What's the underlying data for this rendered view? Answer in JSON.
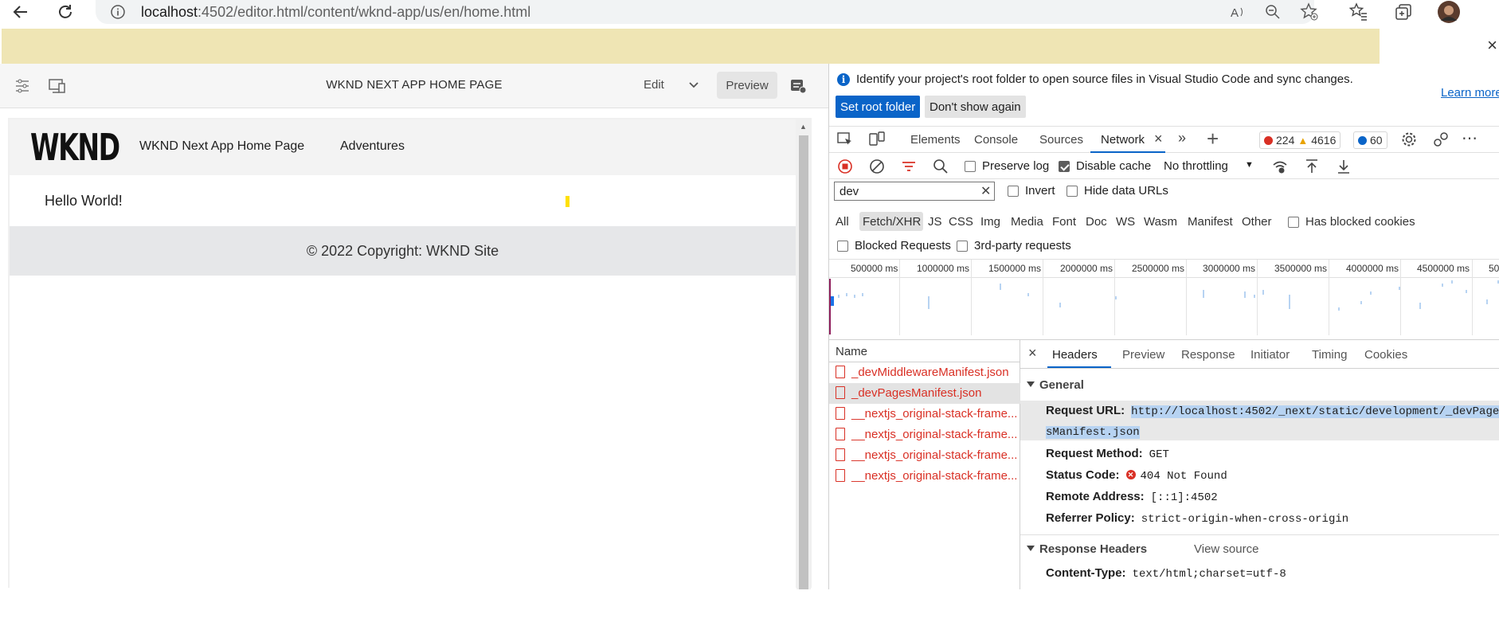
{
  "browser": {
    "url_host": "localhost",
    "url_rest": ":4502/editor.html/content/wknd-app/us/en/home.html",
    "infobar_close": "×"
  },
  "editor": {
    "page_title": "WKND NEXT APP HOME PAGE",
    "edit_label": "Edit",
    "preview_label": "Preview"
  },
  "site": {
    "logo": "WKND",
    "nav": [
      "WKND Next App Home Page",
      "Adventures"
    ],
    "hello": "Hello World!",
    "footer": "© 2022 Copyright: WKND Site"
  },
  "devtools": {
    "notice": "Identify your project's root folder to open source files in Visual Studio Code and sync changes.",
    "set_root_folder": "Set root folder",
    "dont_show_again": "Don't show again",
    "learn_more": "Learn more",
    "tabs": [
      "Elements",
      "Console",
      "Sources",
      "Network"
    ],
    "errors": "224",
    "warnings": "4616",
    "messages": "60",
    "toolbar": {
      "preserve_log": "Preserve log",
      "disable_cache": "Disable cache",
      "throttling": "No throttling"
    },
    "filter": {
      "value": "dev",
      "invert": "Invert",
      "hide_data_urls": "Hide data URLs",
      "types": [
        "All",
        "Fetch/XHR",
        "JS",
        "CSS",
        "Img",
        "Media",
        "Font",
        "Doc",
        "WS",
        "Wasm",
        "Manifest",
        "Other"
      ],
      "has_blocked_cookies": "Has blocked cookies",
      "blocked_requests": "Blocked Requests",
      "third_party": "3rd-party requests"
    },
    "timeline_ticks": [
      "500000 ms",
      "1000000 ms",
      "1500000 ms",
      "2000000 ms",
      "2500000 ms",
      "3000000 ms",
      "3500000 ms",
      "4000000 ms",
      "4500000 ms",
      "50"
    ],
    "name_header": "Name",
    "requests": [
      "_devMiddlewareManifest.json",
      "_devPagesManifest.json",
      "__nextjs_original-stack-frame...",
      "__nextjs_original-stack-frame...",
      "__nextjs_original-stack-frame...",
      "__nextjs_original-stack-frame..."
    ],
    "detail_tabs": [
      "Headers",
      "Preview",
      "Response",
      "Initiator",
      "Timing",
      "Cookies"
    ],
    "general": {
      "title": "General",
      "request_url_label": "Request URL:",
      "request_url_line1": "http://localhost:4502/_next/static/development/_devPage",
      "request_url_line2": "sManifest.json",
      "request_method_label": "Request Method:",
      "request_method": "GET",
      "status_code_label": "Status Code:",
      "status_code": "404 Not Found",
      "remote_address_label": "Remote Address:",
      "remote_address": "[::1]:4502",
      "referrer_policy_label": "Referrer Policy:",
      "referrer_policy": "strict-origin-when-cross-origin"
    },
    "response_headers": {
      "title": "Response Headers",
      "view_source": "View source",
      "content_type_label": "Content-Type:",
      "content_type": "text/html;charset=utf-8"
    }
  }
}
